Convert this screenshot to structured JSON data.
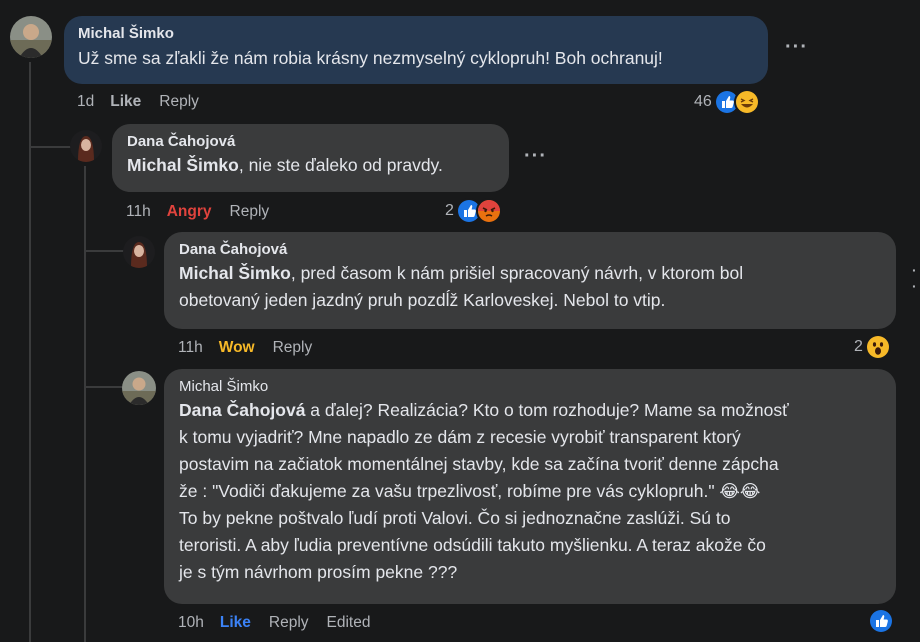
{
  "comments": [
    {
      "author": "Michal Šimko",
      "text": "Už sme sa zľakli že nám robia krásny nezmyselný cyklopruh! Boh ochranuj!",
      "time": "1d",
      "like_label": "Like",
      "reply_label": "Reply",
      "reaction_count": "46",
      "reaction_icons": [
        "like-icon",
        "laugh-emoji-icon"
      ]
    },
    {
      "author": "Dana Čahojová",
      "mention": "Michal Šimko",
      "text": ", nie ste ďaleko od pravdy.",
      "time": "11h",
      "reaction_label": "Angry",
      "reply_label": "Reply",
      "reaction_count": "2",
      "reaction_icons": [
        "like-icon",
        "angry-emoji-icon"
      ]
    },
    {
      "author": "Dana Čahojová",
      "mention": "Michal Šimko",
      "text_line1": ", pred časom k nám prišiel spracovaný návrh, v ktorom bol",
      "text_line2": "obetovaný jeden jazdný pruh pozdĺž Karloveskej. Nebol to vtip.",
      "time": "11h",
      "reaction_label": "Wow",
      "reply_label": "Reply",
      "reaction_count": "2",
      "reaction_icons": [
        "wow-emoji-icon"
      ]
    },
    {
      "author": "Michal Šimko",
      "mention": "Dana Čahojová",
      "lines": [
        " a ďalej? Realizácia? Kto o tom rozhoduje? Mame sa možnosť",
        "k tomu vyjadriť? Mne napadlo ze dám z recesie vyrobiť transparent ktorý",
        "postavim na začiatok momentálnej stavby, kde sa začína tvoriť denne zápcha",
        "že : \"Vodiči ďakujeme za vašu trpezlivosť, robíme pre vás cyklopruh.\" 😂😂",
        "To by pekne poštvalo ľudí proti Valovi. Čo si jednoznačne zaslúži. Sú to",
        "teroristi. A aby ľudia preventívne odsúdili takuto myšlienku. A teraz akože čo",
        "je s tým návrhom prosím pekne ???"
      ],
      "time": "10h",
      "like_label": "Like",
      "reply_label": "Reply",
      "edited_label": "Edited",
      "reaction_icons": [
        "like-icon"
      ]
    }
  ],
  "colors": {
    "background": "#18191a",
    "bubble": "#3a3b3c",
    "highlight_bubble": "#263951",
    "like_blue": "#3b82f6",
    "angry_red": "#e0433d",
    "wow_yellow": "#f7b928"
  },
  "more_glyph": "···"
}
